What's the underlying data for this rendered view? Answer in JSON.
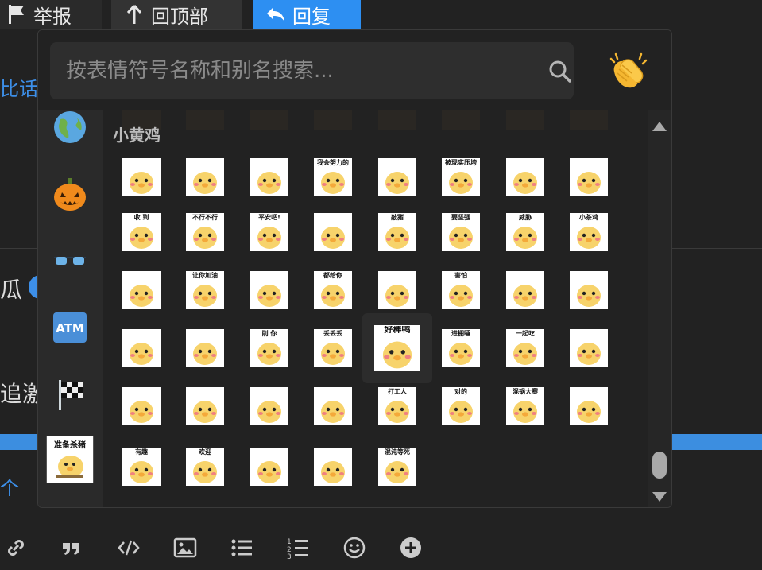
{
  "topbar": {
    "flag_label": "举报",
    "totop_label": "回顶部",
    "reply_label": "回复"
  },
  "background": {
    "snippet_1": "比话",
    "snippet_2": "瓜",
    "snippet_3": "追激",
    "snippet_4": "个"
  },
  "picker": {
    "search": {
      "placeholder": "按表情符号名称和别名搜索...",
      "value": ""
    },
    "clap_icon": "clapping-hands-icon",
    "categories": [
      {
        "name": "globe-icon"
      },
      {
        "name": "jack-o-lantern-icon"
      },
      {
        "name": "sunglasses-icon"
      },
      {
        "name": "atm-icon",
        "label": "ATM"
      },
      {
        "name": "chequered-flag-icon"
      },
      {
        "name": "custom-sticker-icon",
        "label": "准备杀猪"
      }
    ],
    "section_title": "小黄鸡",
    "stickers": [
      "",
      "",
      "",
      "我会努力的",
      "",
      "被现实压垮",
      "",
      "",
      "收  到",
      "不行不行",
      "平安吧!",
      "",
      "敲猪",
      "要坚强",
      "威胁",
      "小茶鸡",
      "",
      "让你加油",
      "",
      "都给你",
      "",
      "害怕",
      "",
      "",
      "",
      "",
      "削  你",
      "丢丢丢",
      "好棒鸭",
      "进棚睡",
      "一起吃",
      "",
      "",
      "",
      "",
      "",
      "打工人",
      "对的",
      "混锅大赛",
      "",
      "有趣",
      "欢迎",
      "",
      "",
      "混沌等死"
    ],
    "hovered_index": 28
  },
  "editor_toolbar": {
    "buttons": [
      "link-icon",
      "quote-icon",
      "code-icon",
      "image-icon",
      "bullet-list-icon",
      "numbered-list-icon",
      "emoji-icon",
      "add-icon"
    ]
  },
  "colors": {
    "accent": "#2d8ff2",
    "background": "#222222",
    "rail": "#2a2a2a"
  }
}
